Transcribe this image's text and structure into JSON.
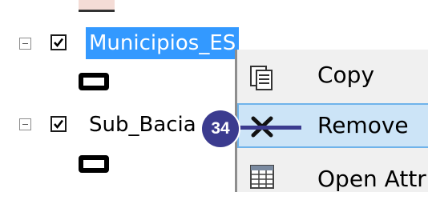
{
  "toc": {
    "layers": [
      {
        "label": "Municipios_ES",
        "checked": true,
        "selected": true
      },
      {
        "label": "Sub_Bacia",
        "checked": true,
        "selected": false
      }
    ]
  },
  "context_menu": {
    "items": [
      {
        "label": "Copy",
        "icon": "copy-icon"
      },
      {
        "label": "Remove",
        "icon": "remove-x-icon",
        "highlighted": true
      },
      {
        "label": "Open Attr",
        "icon": "attribute-table-icon"
      }
    ]
  },
  "annotation": {
    "step": "34"
  },
  "colors": {
    "selection": "#3399ff",
    "menu_highlight": "#cce4f7",
    "badge": "#3b3b8f"
  }
}
